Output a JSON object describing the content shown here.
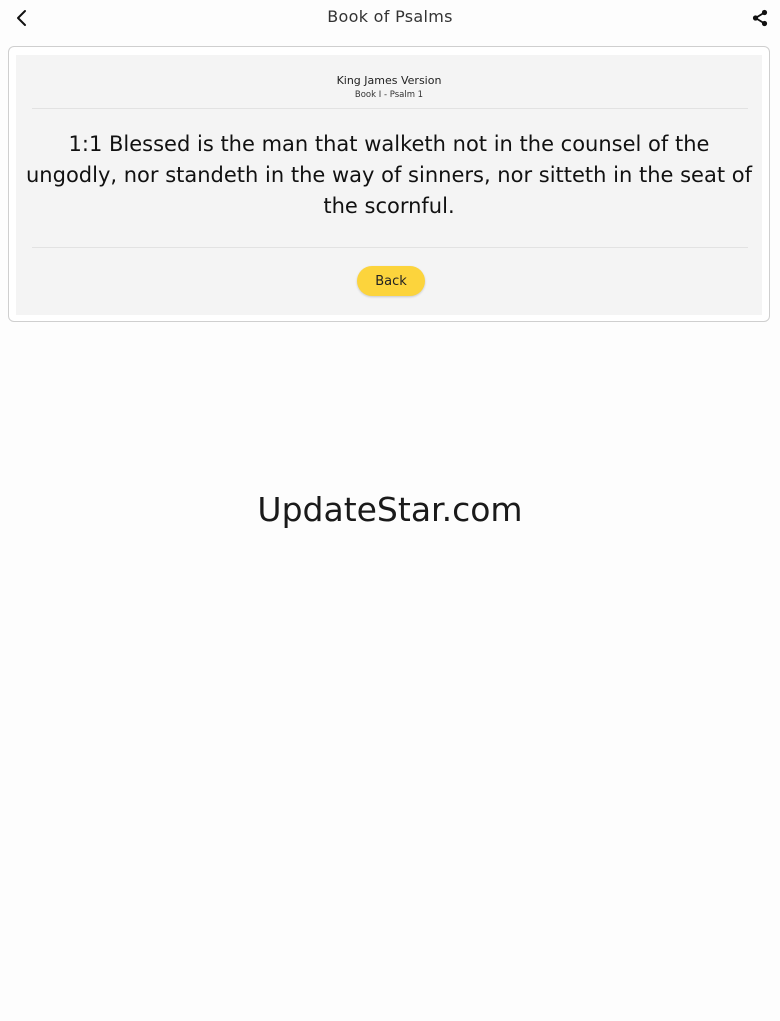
{
  "header": {
    "title": "Book of Psalms",
    "back_icon": "chevron-left-icon",
    "share_icon": "share-icon"
  },
  "card": {
    "version": "King James Version",
    "subtitle": "Book I - Psalm 1",
    "verse": "1:1 Blessed is the man that walketh not in the counsel of the ungodly, nor standeth in the way of sinners, nor sitteth in the seat of the scornful.",
    "back_label": "Back",
    "button_color": "#fcd43c"
  },
  "watermark": "UpdateStar.com"
}
